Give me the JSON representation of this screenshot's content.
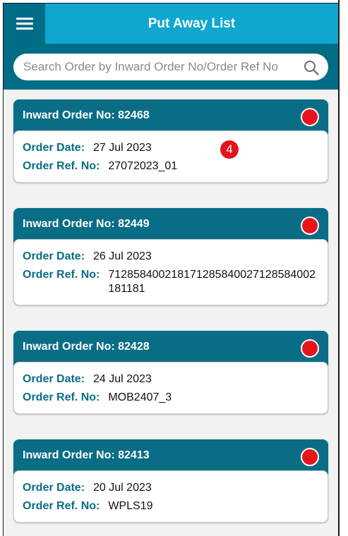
{
  "header": {
    "title": "Put Away List"
  },
  "search": {
    "placeholder": "Search Order by Inward Order No/Order Ref No"
  },
  "labels": {
    "order_date": "Order Date:",
    "order_ref": "Order Ref. No:"
  },
  "notification_badge": "4",
  "colors": {
    "primary_dark": "#006d86",
    "primary_light": "#0fa6cf",
    "status_red": "#e8141c"
  },
  "orders": [
    {
      "header": "Inward Order No: 82468",
      "date": "27 Jul 2023",
      "ref": "27072023_01"
    },
    {
      "header": "Inward Order No: 82449",
      "date": "26 Jul 2023",
      "ref": "712858400218171285840027128584002181181"
    },
    {
      "header": "Inward Order No: 82428",
      "date": "24 Jul 2023",
      "ref": "MOB2407_3"
    },
    {
      "header": "Inward Order No: 82413",
      "date": "20 Jul 2023",
      "ref": "WPLS19"
    }
  ]
}
